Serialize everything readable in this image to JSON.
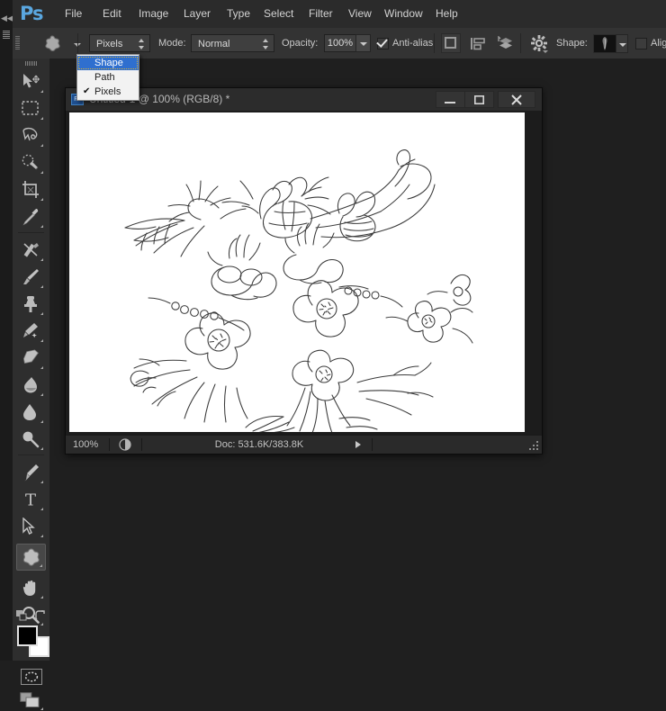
{
  "app": {
    "name": "Photoshop",
    "logo_text": "Ps",
    "accent_color": "#5aa7e0"
  },
  "menubar": {
    "items": [
      {
        "label": "File"
      },
      {
        "label": "Edit"
      },
      {
        "label": "Image"
      },
      {
        "label": "Layer"
      },
      {
        "label": "Type"
      },
      {
        "label": "Select"
      },
      {
        "label": "Filter"
      },
      {
        "label": "View"
      },
      {
        "label": "Window"
      },
      {
        "label": "Help"
      }
    ]
  },
  "options_bar": {
    "tool_preset_icon": "custom-shape-icon",
    "mode_select": {
      "value": "Pixels",
      "options": [
        "Shape",
        "Path",
        "Pixels"
      ]
    },
    "mode_label": "Mode:",
    "blend_mode": {
      "value": "Normal"
    },
    "opacity_label": "Opacity:",
    "opacity_value": "100%",
    "antialias_label": "Anti-alias",
    "antialias_checked": true,
    "shape_label": "Shape:",
    "align_edges_label": "Align Ed",
    "align_edges_checked": false,
    "path_op_icons": [
      "path-operations-icon",
      "path-alignment-icon",
      "path-arrangement-icon"
    ],
    "settings_icon": "gear-icon"
  },
  "dropdown": {
    "open": true,
    "items": [
      {
        "label": "Shape",
        "selected": true,
        "checked": false
      },
      {
        "label": "Path",
        "selected": false,
        "checked": false
      },
      {
        "label": "Pixels",
        "selected": false,
        "checked": true
      }
    ],
    "check_glyph": "✔",
    "highlight_color": "#2f6fcf"
  },
  "toolbox": {
    "tools": [
      {
        "name": "move-tool",
        "active": false
      },
      {
        "name": "rectangular-marquee-tool",
        "active": false
      },
      {
        "name": "lasso-tool",
        "active": false
      },
      {
        "name": "quick-selection-tool",
        "active": false
      },
      {
        "name": "crop-tool",
        "active": false
      },
      {
        "name": "eyedropper-tool",
        "active": false
      },
      {
        "name": "spot-healing-brush-tool",
        "active": false
      },
      {
        "name": "brush-tool",
        "active": false
      },
      {
        "name": "clone-stamp-tool",
        "active": false
      },
      {
        "name": "history-brush-tool",
        "active": false
      },
      {
        "name": "eraser-tool",
        "active": false
      },
      {
        "name": "gradient-tool",
        "active": false
      },
      {
        "name": "blur-tool",
        "active": false
      },
      {
        "name": "dodge-tool",
        "active": false
      },
      {
        "name": "pen-tool",
        "active": false
      },
      {
        "name": "type-tool",
        "active": false
      },
      {
        "name": "path-selection-tool",
        "active": false
      },
      {
        "name": "custom-shape-tool",
        "active": true
      },
      {
        "name": "hand-tool",
        "active": false
      },
      {
        "name": "zoom-tool",
        "active": false
      }
    ],
    "type_tool_glyph": "T",
    "foreground_color": "#000000",
    "background_color": "#ffffff",
    "quick_mask_name": "quick-mask-mode-icon",
    "screen_mode_name": "screen-mode-icon"
  },
  "document": {
    "title": "Untitled-1 @ 100% (RGB/8) *",
    "window_buttons": {
      "minimize": "–",
      "maximize": "□",
      "close": "✕"
    },
    "canvas_background": "#ffffff",
    "artwork": "floral-bouquet-line-drawing"
  },
  "status_bar": {
    "zoom": "100%",
    "doc_info": "Doc: 531.6K/383.8K",
    "expand_icon": "play-triangle-icon"
  }
}
